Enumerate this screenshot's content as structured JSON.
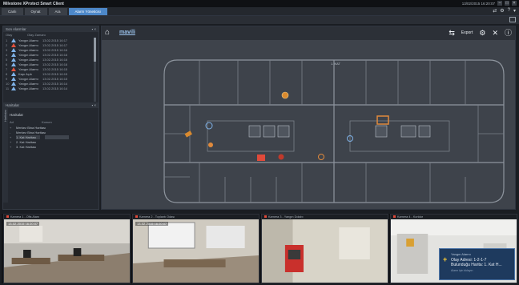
{
  "app": {
    "title": "Milestone XProtect Smart Client",
    "clock": "13/02/2015 16:20:07"
  },
  "tabs": [
    {
      "label": "Canlı"
    },
    {
      "label": "Oynat"
    },
    {
      "label": "Ara"
    },
    {
      "label": "Alarm Yöneticisi"
    }
  ],
  "alarm_panel": {
    "title": "Son Alarmlar",
    "columns": [
      "Olay",
      "Olay Zamanı"
    ],
    "rows": [
      {
        "num": "1",
        "name": "Yangın Alarmı",
        "date": "13.02.2015 16:17",
        "color": "blue"
      },
      {
        "num": "2",
        "name": "Yangın Alarmı",
        "date": "13.02.2015 16:17",
        "color": "red"
      },
      {
        "num": "3",
        "name": "Yangın Alarmı",
        "date": "13.02.2015 16:16",
        "color": "blue"
      },
      {
        "num": "4",
        "name": "Yangın Alarmı",
        "date": "13.02.2015 16:16",
        "color": "blue"
      },
      {
        "num": "5",
        "name": "Yangın Alarmı",
        "date": "13.02.2015 16:16",
        "color": "blue"
      },
      {
        "num": "6",
        "name": "Yangın Alarmı",
        "date": "13.02.2015 16:16",
        "color": "blue"
      },
      {
        "num": "7",
        "name": "Yangın Alarmı",
        "date": "13.02.2015 16:15",
        "color": "red"
      },
      {
        "num": "8",
        "name": "Kapı Açık",
        "date": "13.02.2015 16:15",
        "color": "blue"
      },
      {
        "num": "9",
        "name": "Yangın Alarmı",
        "date": "13.02.2015 16:15",
        "color": "blue"
      },
      {
        "num": "10",
        "name": "Yangın Alarmı",
        "date": "13.02.2015 16:14",
        "color": "blue"
      },
      {
        "num": "11",
        "name": "Yangın Alarmı",
        "date": "13.02.2015 16:14",
        "color": "blue"
      }
    ]
  },
  "tree_panel": {
    "header": "Haritalar",
    "side_tab": "Haritalar",
    "title": "Haritalar",
    "columns": [
      "Ad",
      "Konum"
    ],
    "rows": [
      {
        "bullet": "+",
        "name": "Merkez Bina Haritası"
      },
      {
        "bullet": "-",
        "name": "Merkez Bina Haritası"
      },
      {
        "bullet": "+",
        "name": "1. Kat Haritası"
      },
      {
        "bullet": "+",
        "name": "2. Kat Haritası"
      },
      {
        "bullet": "+",
        "name": "3. Kat Haritası"
      }
    ]
  },
  "main": {
    "brand": "mavili",
    "export_label": "Export",
    "plan_title": "1. KAT"
  },
  "cameras": [
    {
      "title": "Kamera 1 - Ofis Alanı",
      "timestamp": "13-02-2015 16:20:07"
    },
    {
      "title": "Kamera 2 - Toplantı Odası",
      "timestamp": "13-02-2015 16:20:07"
    },
    {
      "title": "Kamera 3 - Yangın Dolabı",
      "timestamp": ""
    },
    {
      "title": "Kamera 4 - Koridor",
      "timestamp": ""
    }
  ],
  "notification": {
    "title": "Yangın Alarmı",
    "line1": "Olay Adresi: 1-2-1-7",
    "line2": "Bulunduğu Harita: 1. Kat H...",
    "footer": "Alarm için tıklayın"
  },
  "colors": {
    "accent": "#4d88c9",
    "alarm_red": "#e0523e",
    "plan_bg": "#3e434b",
    "wall": "#8e959e"
  }
}
